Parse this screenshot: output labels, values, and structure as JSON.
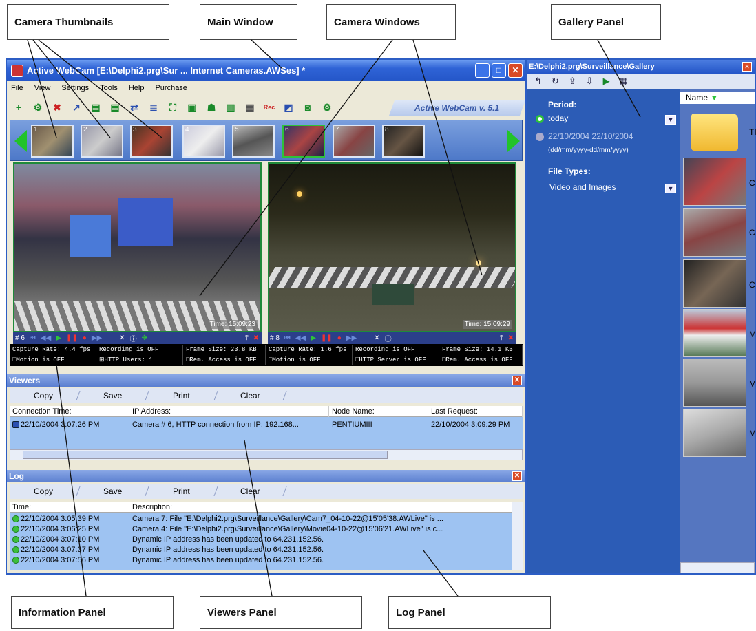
{
  "callouts": {
    "camera_thumbnails": "Camera Thumbnails",
    "main_window": "Main Window",
    "camera_windows": "Camera  Windows",
    "gallery_panel": "Gallery Panel",
    "information_panel": "Information Panel",
    "viewers_panel": "Viewers Panel",
    "log_panel": "Log Panel"
  },
  "main_window": {
    "title": "Active WebCam [E:\\Delphi2.prg\\Sur ... Internet Cameras.AWSes] *",
    "menu": [
      "File",
      "View",
      "Settings",
      "Tools",
      "Help",
      "Purchase"
    ],
    "version_tab": "Active WebCam v. 5.1",
    "thumbnails": [
      "1",
      "2",
      "3",
      "4",
      "5",
      "6",
      "7",
      "8"
    ]
  },
  "cameras": [
    {
      "number": "# 6",
      "time": "Time: 15:09:23",
      "info": [
        "Capture Rate: 4.4 fps",
        "Recording is OFF",
        "Frame Size: 23.8 KB",
        "□Motion is OFF",
        "⊞HTTP Users: 1",
        "□Rem. Access is OFF"
      ]
    },
    {
      "number": "# 8",
      "time": "Time: 15:09:29",
      "info": [
        "Capture Rate: 1.6 fps",
        "Recording is OFF",
        "Frame Size: 14.1 KB",
        "□Motion is OFF",
        "□HTTP Server is OFF",
        "□Rem. Access is OFF"
      ]
    }
  ],
  "viewers": {
    "title": "Viewers",
    "buttons": [
      "Copy",
      "Save",
      "Print",
      "Clear"
    ],
    "columns": [
      "Connection Time:",
      "IP Address:",
      "Node Name:",
      "Last Request:"
    ],
    "rows": [
      {
        "time": "22/10/2004 3:07:26 PM",
        "ip": "Camera # 6, HTTP connection from IP: 192.168...",
        "node": "PENTIUMIII",
        "last": "22/10/2004 3:09:29 PM"
      }
    ]
  },
  "log": {
    "title": "Log",
    "buttons": [
      "Copy",
      "Save",
      "Print",
      "Clear"
    ],
    "columns": [
      "Time:",
      "Description:"
    ],
    "rows": [
      {
        "time": "22/10/2004 3:05:39 PM",
        "desc": "Camera 7: File \"E:\\Delphi2.prg\\Surveillance\\Gallery\\Cam7_04-10-22@15'05'38.AWLive\" is ..."
      },
      {
        "time": "22/10/2004 3:06:25 PM",
        "desc": "Camera 4: File \"E:\\Delphi2.prg\\Surveillance\\Gallery\\Movie04-10-22@15'06'21.AWLive\" is c..."
      },
      {
        "time": "22/10/2004 3:07:10 PM",
        "desc": "Dynamic IP address has been updated to 64.231.152.56."
      },
      {
        "time": "22/10/2004 3:07:37 PM",
        "desc": "Dynamic IP address has been updated to 64.231.152.56."
      },
      {
        "time": "22/10/2004 3:07:56 PM",
        "desc": "Dynamic IP address has been updated to 64.231.152.56."
      }
    ]
  },
  "gallery": {
    "title": "E:\\Delphi2.prg\\Surveillance\\Gallery",
    "period_label": "Period:",
    "period_today": "today",
    "period_range": "22/10/2004 22/10/2004",
    "period_format": "(dd/mm/yyyy-dd/mm/yyyy)",
    "filetypes_label": "File Types:",
    "filetypes_value": "Video and Images",
    "name_column": "Name",
    "file_suffixes": [
      "TI",
      "C",
      "C",
      "C",
      "M",
      "M",
      "M"
    ]
  }
}
